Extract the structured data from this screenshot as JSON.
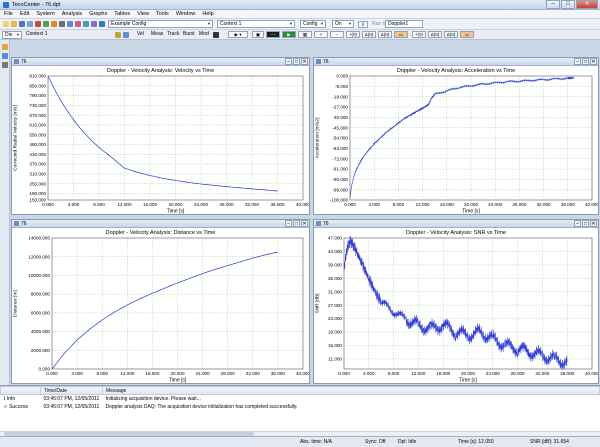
{
  "window": {
    "title": "TecoCenter - 76.dpt"
  },
  "menu": [
    "File",
    "Edit",
    "System",
    "Analysis",
    "Graphs",
    "Tables",
    "View",
    "Tools",
    "Window",
    "Help"
  ],
  "toolbar1": {
    "config_combo": "Example Config",
    "context_combo": "Context 1",
    "config_dropdown": "Config",
    "on_dropdown": "On",
    "run_label": "Run Id",
    "doppler_field": "Doppler1"
  },
  "toolbar2": {
    "mode_combo": "Dis",
    "context_label": "Context 1",
    "buttons": [
      "Vel",
      "Meas",
      "Track",
      "Burst",
      "Mod"
    ],
    "pill_buttons": [
      "+(0)",
      "Δ(0)",
      "Δ(0)",
      "+(0)",
      "Δ(0)",
      "Δ(0)"
    ]
  },
  "colors": {
    "trace": "#2a37d8",
    "grid": "#9dd39d",
    "accent_orange": "#f4c48a"
  },
  "charts": {
    "c1": {
      "window_num": "76",
      "title": "Doppler - Velocity Analysis: Velocity vs Time",
      "ylabel": "Corrected Radial Velocity [m/s]",
      "xlabel": "Time [s]"
    },
    "c2": {
      "window_num": "76",
      "title": "Doppler - Velocity Analysis: Acceleration vs Time",
      "ylabel": "Acceleration [m/s2]",
      "xlabel": "Time [s]"
    },
    "c3": {
      "window_num": "76",
      "title": "Doppler - Velocity Analysis: Distance vs Time",
      "ylabel": "Distance [m]",
      "xlabel": "Time [s]"
    },
    "c4": {
      "window_num": "76",
      "title": "Doppler - Velocity Analysis: SNR vs Time",
      "ylabel": "SNR [dB]",
      "xlabel": "Time [s]"
    }
  },
  "chart_data": [
    {
      "type": "line",
      "title": "Doppler - Velocity Analysis: Velocity vs Time",
      "xlabel": "Time [s]",
      "ylabel": "Corrected Radial Velocity [m/s]",
      "xlim": [
        0,
        40
      ],
      "ylim": [
        150,
        910
      ],
      "xticks": [
        "0.000",
        "4.000",
        "8.000",
        "12.000",
        "16.000",
        "20.000",
        "24.000",
        "28.000",
        "32.000",
        "36.000",
        "40.000"
      ],
      "yticks": [
        "910.000",
        "850.000",
        "790.000",
        "730.000",
        "670.000",
        "610.000",
        "550.000",
        "490.000",
        "430.000",
        "370.000",
        "310.000",
        "250.000",
        "190.000",
        "150.000"
      ],
      "series": [
        {
          "x": [
            0,
            1,
            2,
            3,
            4,
            5,
            6,
            7,
            8,
            10,
            12,
            14,
            16,
            18,
            20,
            22,
            24,
            26,
            28,
            30,
            32,
            34,
            36
          ],
          "y": [
            910,
            830,
            760,
            698,
            642,
            592,
            548,
            508,
            472,
            410,
            345,
            320,
            300,
            283,
            270,
            258,
            248,
            240,
            232,
            225,
            218,
            212,
            205
          ]
        }
      ],
      "grid": true
    },
    {
      "type": "line",
      "title": "Doppler - Velocity Analysis: Acceleration vs Time",
      "xlabel": "Time [s]",
      "ylabel": "Acceleration [m/s2]",
      "xlim": [
        0,
        40
      ],
      "ylim": [
        -108,
        0
      ],
      "xticks": [
        "0.000",
        "4.000",
        "8.000",
        "12.000",
        "16.000",
        "20.000",
        "24.000",
        "28.000",
        "32.000",
        "36.000",
        "40.000"
      ],
      "yticks": [
        "0.000",
        "-9.000",
        "-18.000",
        "-27.000",
        "-36.000",
        "-45.000",
        "-54.000",
        "-63.000",
        "-72.000",
        "-81.000",
        "-90.000",
        "-99.000",
        "-108.000"
      ],
      "series": [
        {
          "x": [
            0,
            0.3,
            0.6,
            1,
            1.5,
            2,
            3,
            4,
            5,
            6,
            7,
            8,
            9,
            10,
            11,
            12,
            13,
            13.5,
            14,
            16,
            18,
            20,
            22,
            24,
            26,
            28,
            30,
            32,
            34,
            36,
            37
          ],
          "y": [
            -106,
            -95,
            -88,
            -82,
            -77,
            -72,
            -65,
            -59,
            -54,
            -49,
            -45,
            -41,
            -37,
            -34,
            -31,
            -28,
            -25,
            -19,
            -16,
            -13,
            -10,
            -8.5,
            -7,
            -6,
            -5,
            -4.5,
            -3.8,
            -3.2,
            -2.5,
            -2,
            -1.5
          ]
        }
      ],
      "grid": true
    },
    {
      "type": "line",
      "title": "Doppler - Velocity Analysis: Distance vs Time",
      "xlabel": "Time [s]",
      "ylabel": "Distance [m]",
      "xlim": [
        0,
        40
      ],
      "ylim": [
        0,
        14000
      ],
      "xticks": [
        "0.000",
        "4.000",
        "8.000",
        "12.000",
        "16.000",
        "20.000",
        "24.000",
        "28.000",
        "32.000",
        "36.000",
        "40.000"
      ],
      "yticks": [
        "14000.000",
        "12000.000",
        "10000.000",
        "8000.000",
        "6000.000",
        "4000.000",
        "2000.000",
        "0.000"
      ],
      "series": [
        {
          "x": [
            0,
            2,
            4,
            6,
            8,
            10,
            12,
            14,
            16,
            18,
            20,
            22,
            24,
            26,
            28,
            30,
            32,
            34,
            36
          ],
          "y": [
            0,
            1700,
            3100,
            4250,
            5250,
            6100,
            6850,
            7500,
            8100,
            8650,
            9200,
            9700,
            10200,
            10650,
            11050,
            11450,
            11850,
            12200,
            12500
          ]
        }
      ],
      "grid": true
    },
    {
      "type": "line",
      "title": "Doppler - Velocity Analysis: SNR vs Time",
      "xlabel": "Time [s]",
      "ylabel": "SNR [dB]",
      "xlim": [
        0,
        40
      ],
      "ylim": [
        8,
        47
      ],
      "xticks": [
        "0.000",
        "4.000",
        "8.000",
        "12.000",
        "16.000",
        "20.000",
        "24.000",
        "28.000",
        "32.000",
        "36.000",
        "40.000"
      ],
      "yticks": [
        "47.000",
        "43.000",
        "39.000",
        "35.000",
        "31.000",
        "27.000",
        "23.000",
        "19.000",
        "15.000",
        "11.000"
      ],
      "series": [
        {
          "x": [
            0,
            0.5,
            1,
            1.5,
            2,
            3,
            4,
            5,
            6,
            8,
            10,
            12,
            14,
            16,
            18,
            20,
            22,
            24,
            26,
            28,
            30,
            32,
            34,
            36
          ],
          "y": [
            38,
            44,
            46,
            45,
            43,
            39,
            35,
            31,
            28,
            25,
            23,
            21,
            20,
            21,
            19,
            18,
            19,
            17,
            15,
            14,
            13,
            12,
            11,
            10
          ]
        }
      ],
      "grid": true
    }
  ],
  "status_panel": {
    "headers": [
      "",
      "Time/Date",
      "Message"
    ],
    "rows": [
      {
        "type": "Info",
        "time": "03:45:07 PM, 12/05/2011",
        "message": "Initializing acquisition device. Please wait..."
      },
      {
        "type": "Success",
        "time": "03:45:07 PM, 12/05/2011",
        "message": "Doppler analysis DAQ: The acquisition device initialization has completed successfully."
      }
    ]
  },
  "statusbar": {
    "altitude": "Abs. time: N/A",
    "sync": "Sync: Off",
    "daq": "Dpl: Idle",
    "time": "Time [s]: 12.050",
    "snr": "SNR [dB]: 31.654"
  }
}
